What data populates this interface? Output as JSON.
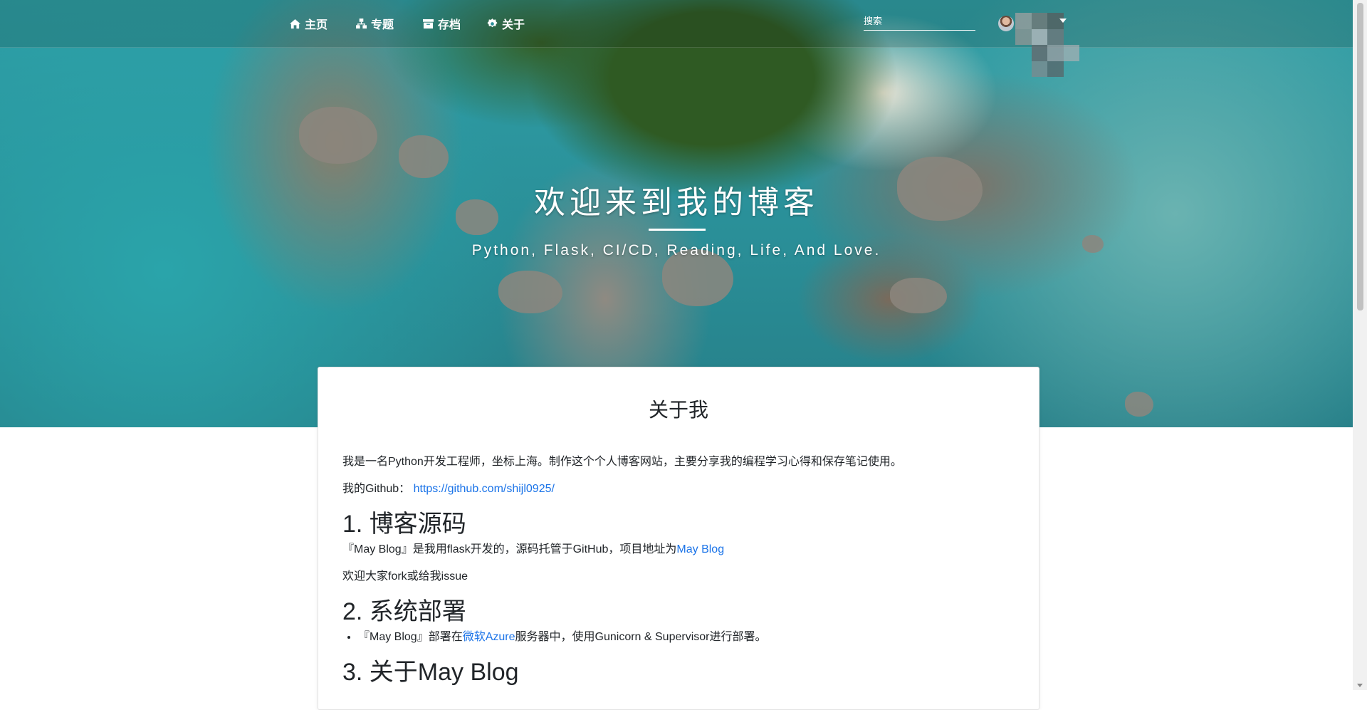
{
  "nav": {
    "items": [
      {
        "label": "主页",
        "icon": "home-icon"
      },
      {
        "label": "专题",
        "icon": "sitemap-icon"
      },
      {
        "label": "存档",
        "icon": "archive-icon"
      },
      {
        "label": "关于",
        "icon": "settings-icon"
      }
    ],
    "search_placeholder": "搜索"
  },
  "hero": {
    "title": "欢迎来到我的博客",
    "subtitle": "Python, Flask, CI/CD, Reading, Life, And Love."
  },
  "about": {
    "title": "关于我",
    "intro": "我是一名Python开发工程师，坐标上海。制作这个个人博客网站，主要分享我的编程学习心得和保存笔记使用。",
    "github_label": "我的Github：",
    "github_link": "https://github.com/shijl0925/",
    "section1_heading": "1. 博客源码",
    "section1_text": "『May Blog』是我用flask开发的，源码托管于GitHub，项目地址为",
    "section1_link": "May Blog",
    "section1_extra": "欢迎大家fork或给我issue",
    "section2_heading": "2. 系统部署",
    "section2_prefix": "『May Blog』部署在",
    "section2_link": "微软Azure",
    "section2_suffix": "服务器中，使用Gunicorn & Supervisor进行部署。",
    "section3_heading": "3. 关于May Blog"
  },
  "colors": {
    "link": "#1a73e8",
    "nav_text": "#ffffff"
  }
}
